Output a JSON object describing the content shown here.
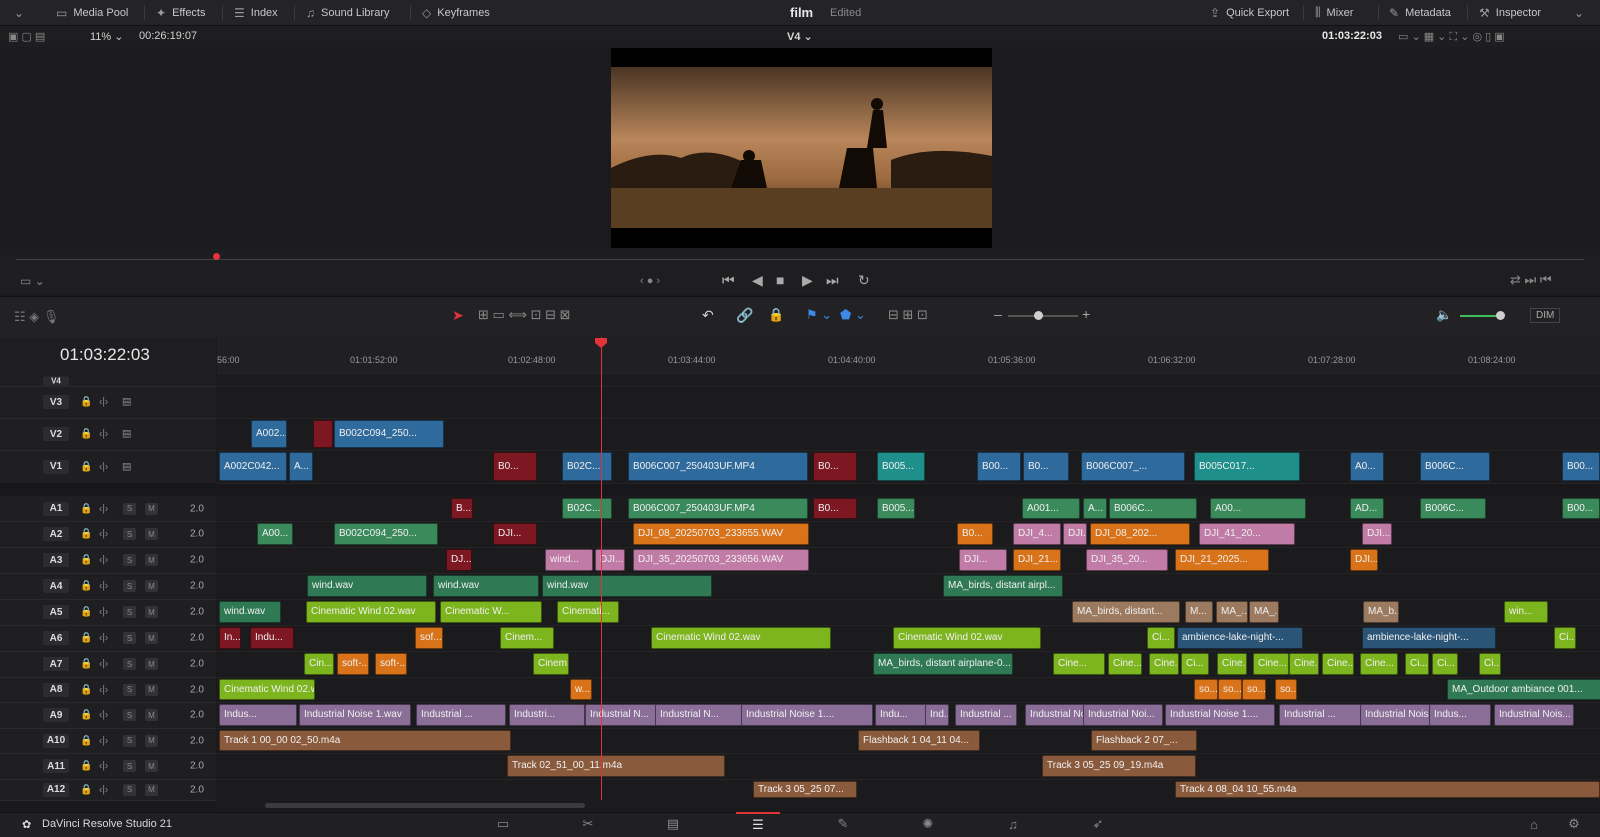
{
  "topbar": {
    "media_pool": "Media Pool",
    "effects": "Effects",
    "index": "Index",
    "sound_library": "Sound Library",
    "keyframes": "Keyframes",
    "project_name": "film",
    "project_status": "Edited",
    "quick_export": "Quick Export",
    "mixer": "Mixer",
    "metadata": "Metadata",
    "inspector": "Inspector"
  },
  "viewer_bar": {
    "zoom": "11%",
    "duration": "00:26:19:07",
    "track_select": "V4",
    "timecode": "01:03:22:03"
  },
  "timeline": {
    "current_timecode": "01:03:22:03",
    "ruler_ticks": [
      "56:00",
      "01:01:52:00",
      "01:02:48:00",
      "01:03:44:00",
      "01:04:40:00",
      "01:05:36:00",
      "01:06:32:00",
      "01:07:28:00",
      "01:08:24:00"
    ],
    "video_tracks": [
      "V4",
      "V3",
      "V2",
      "V1"
    ],
    "audio_tracks": [
      "A1",
      "A2",
      "A3",
      "A4",
      "A5",
      "A6",
      "A7",
      "A8",
      "A9",
      "A10",
      "A11",
      "A12"
    ],
    "audio_level": "2.0",
    "solo_label": "S",
    "mute_label": "M",
    "dim_label": "DIM",
    "colors": {
      "blue": "#2f6a9c",
      "teal": "#1f8f8b",
      "red": "#7d1822",
      "green": "#3b8a5c",
      "orange": "#d9731a",
      "pink": "#c07ba6",
      "lime": "#7db51f",
      "brown": "#8a5a3d",
      "lavender": "#8a6e98",
      "tan": "#9c7a60",
      "dgreen": "#2f7a55",
      "navy": "#2a5577"
    }
  },
  "clips": {
    "v2": [
      {
        "label": "A002...",
        "color": "blue"
      },
      {
        "label": "",
        "color": "red"
      },
      {
        "label": "B002C094_250...",
        "color": "blue"
      }
    ],
    "v1": [
      {
        "label": "A002C042...",
        "color": "blue"
      },
      {
        "label": "A...",
        "color": "blue"
      },
      {
        "label": "B0...",
        "color": "red"
      },
      {
        "label": "B02C...",
        "color": "blue"
      },
      {
        "label": "B006C007_250403UF.MP4",
        "color": "blue"
      },
      {
        "label": "B0...",
        "color": "red"
      },
      {
        "label": "B005...",
        "color": "teal"
      },
      {
        "label": "B00...",
        "color": "blue"
      },
      {
        "label": "B0...",
        "color": "blue"
      },
      {
        "label": "B006C007_...",
        "color": "blue"
      },
      {
        "label": "B005C017...",
        "color": "teal"
      },
      {
        "label": "A0...",
        "color": "blue"
      },
      {
        "label": "B006C...",
        "color": "blue"
      },
      {
        "label": "B00...",
        "color": "blue"
      }
    ],
    "a1": [
      {
        "label": "B...",
        "color": "red"
      },
      {
        "label": "B02C...",
        "color": "green"
      },
      {
        "label": "B006C007_250403UF.MP4",
        "color": "green"
      },
      {
        "label": "B0...",
        "color": "red"
      },
      {
        "label": "B005...",
        "color": "green"
      },
      {
        "label": "A001...",
        "color": "green"
      },
      {
        "label": "A...",
        "color": "green"
      },
      {
        "label": "B006C...",
        "color": "green"
      },
      {
        "label": "A00...",
        "color": "green"
      },
      {
        "label": "AD...",
        "color": "green"
      },
      {
        "label": "B006C...",
        "color": "green"
      },
      {
        "label": "B00...",
        "color": "green"
      }
    ],
    "a2": [
      {
        "label": "A00...",
        "color": "green"
      },
      {
        "label": "B002C094_250...",
        "color": "green"
      },
      {
        "label": "DJI...",
        "color": "red"
      },
      {
        "label": "DJI_08_20250703_233655.WAV",
        "color": "orange"
      },
      {
        "label": "B0...",
        "color": "orange"
      },
      {
        "label": "DJI_4...",
        "color": "pink"
      },
      {
        "label": "DJI...",
        "color": "pink"
      },
      {
        "label": "DJI_08_202...",
        "color": "orange"
      },
      {
        "label": "DJI_41_20...",
        "color": "pink"
      },
      {
        "label": "DJI...",
        "color": "pink"
      }
    ],
    "a3": [
      {
        "label": "DJ...",
        "color": "red"
      },
      {
        "label": "wind...",
        "color": "pink"
      },
      {
        "label": "DJI...",
        "color": "pink"
      },
      {
        "label": "DJI_35_20250703_233656.WAV",
        "color": "pink"
      },
      {
        "label": "DJI...",
        "color": "pink"
      },
      {
        "label": "DJI_21...",
        "color": "orange"
      },
      {
        "label": "DJI_35_20...",
        "color": "pink"
      },
      {
        "label": "DJI_21_2025...",
        "color": "orange"
      },
      {
        "label": "DJI...",
        "color": "orange"
      }
    ],
    "a4": [
      {
        "label": "wind.wav",
        "color": "dgreen"
      },
      {
        "label": "wind.wav",
        "color": "dgreen"
      },
      {
        "label": "wind.wav",
        "color": "dgreen"
      },
      {
        "label": "MA_birds, distant airpl...",
        "color": "dgreen"
      }
    ],
    "a5": [
      {
        "label": "wind.wav",
        "color": "dgreen"
      },
      {
        "label": "Cinematic Wind 02.wav",
        "color": "lime"
      },
      {
        "label": "Cinematic W...",
        "color": "lime"
      },
      {
        "label": "Cinemati...",
        "color": "lime"
      },
      {
        "label": "MA_birds, distant...",
        "color": "tan"
      },
      {
        "label": "M...",
        "color": "tan"
      },
      {
        "label": "MA_...",
        "color": "tan"
      },
      {
        "label": "MA_...",
        "color": "tan"
      },
      {
        "label": "MA_b...",
        "color": "tan"
      },
      {
        "label": "win...",
        "color": "lime"
      }
    ],
    "a6": [
      {
        "label": "In...",
        "color": "red"
      },
      {
        "label": "Indu...",
        "color": "red"
      },
      {
        "label": "sof...",
        "color": "orange"
      },
      {
        "label": "Cinem...",
        "color": "lime"
      },
      {
        "label": "Cinematic Wind 02.wav",
        "color": "lime"
      },
      {
        "label": "Cinematic Wind 02.wav",
        "color": "lime"
      },
      {
        "label": "Ci...",
        "color": "lime"
      },
      {
        "label": "ambience-lake-night-...",
        "color": "navy"
      },
      {
        "label": "ambience-lake-night-...",
        "color": "navy"
      },
      {
        "label": "Ci...",
        "color": "lime"
      }
    ],
    "a7": [
      {
        "label": "Cin...",
        "color": "lime"
      },
      {
        "label": "soft-...",
        "color": "orange"
      },
      {
        "label": "soft-...",
        "color": "orange"
      },
      {
        "label": "Cinem...",
        "color": "lime"
      },
      {
        "label": "MA_birds, distant airplane-0...",
        "color": "dgreen"
      },
      {
        "label": "Cine...",
        "color": "lime"
      },
      {
        "label": "Cine...",
        "color": "lime"
      },
      {
        "label": "Cine...",
        "color": "lime"
      },
      {
        "label": "Ci...",
        "color": "lime"
      },
      {
        "label": "Cine...",
        "color": "lime"
      },
      {
        "label": "Cine...",
        "color": "lime"
      },
      {
        "label": "Cine...",
        "color": "lime"
      },
      {
        "label": "Cine...",
        "color": "lime"
      },
      {
        "label": "Cine...",
        "color": "lime"
      },
      {
        "label": "Ci...",
        "color": "lime"
      },
      {
        "label": "Ci...",
        "color": "lime"
      },
      {
        "label": "Ci...",
        "color": "lime"
      }
    ],
    "a8": [
      {
        "label": "Cinematic Wind 02.w...",
        "color": "lime"
      },
      {
        "label": "w...",
        "color": "orange"
      },
      {
        "label": "so...",
        "color": "orange"
      },
      {
        "label": "so...",
        "color": "orange"
      },
      {
        "label": "so...",
        "color": "orange"
      },
      {
        "label": "so...",
        "color": "orange"
      },
      {
        "label": "MA_Outdoor ambiance 001...",
        "color": "dgreen"
      }
    ],
    "a9": [
      {
        "label": "Indus...",
        "color": "lavender"
      },
      {
        "label": "Industrial Noise 1.wav",
        "color": "lavender"
      },
      {
        "label": "Industrial ...",
        "color": "lavender"
      },
      {
        "label": "Industri...",
        "color": "lavender"
      },
      {
        "label": "Industrial N...",
        "color": "lavender"
      },
      {
        "label": "Industrial N...",
        "color": "lavender"
      },
      {
        "label": "Industrial Noise 1....",
        "color": "lavender"
      },
      {
        "label": "Indu...",
        "color": "lavender"
      },
      {
        "label": "Ind...",
        "color": "lavender"
      },
      {
        "label": "Industrial ...",
        "color": "lavender"
      },
      {
        "label": "Industrial Noi...",
        "color": "lavender"
      },
      {
        "label": "Industrial Noi...",
        "color": "lavender"
      },
      {
        "label": "Industrial Noise 1....",
        "color": "lavender"
      },
      {
        "label": "Industrial ...",
        "color": "lavender"
      },
      {
        "label": "Industrial Nois...",
        "color": "lavender"
      },
      {
        "label": "Indus...",
        "color": "lavender"
      },
      {
        "label": "Industrial Nois...",
        "color": "lavender"
      }
    ],
    "a10": [
      {
        "label": "Track 1 00_00 02_50.m4a",
        "color": "brown"
      },
      {
        "label": "Flashback 1 04_11 04...",
        "color": "brown"
      },
      {
        "label": "Flashback 2 07_...",
        "color": "brown"
      }
    ],
    "a11": [
      {
        "label": "Track 02_51_00_11.m4a",
        "color": "brown"
      },
      {
        "label": "Track 3 05_25 09_19.m4a",
        "color": "brown"
      }
    ],
    "a12": [
      {
        "label": "Track 3 05_25 07...",
        "color": "brown"
      },
      {
        "label": "Track 4 08_04 10_55.m4a",
        "color": "brown"
      }
    ]
  },
  "bottombar": {
    "app_name": "DaVinci Resolve Studio 21"
  }
}
